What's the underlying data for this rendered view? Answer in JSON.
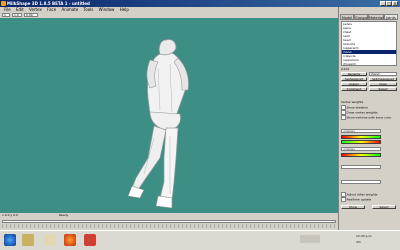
{
  "window": {
    "title": "MilkShape 3D 1.8.5 BETA 1 - untitled",
    "minimize": "_",
    "maximize": "□",
    "close": "×"
  },
  "menu": [
    "File",
    "Edit",
    "Vertex",
    "Face",
    "Animate",
    "Tools",
    "Window",
    "Help"
  ],
  "toolbar": {
    "frame_field": "1",
    "zoom_field": "1.0",
    "extra_field": "0.00"
  },
  "viewport": {
    "background": "#3d8f86"
  },
  "status": {
    "coords": "x 0.0 y 0.0",
    "message": "Ready"
  },
  "panel": {
    "tabs": [
      "Model",
      "Groups",
      "Materials",
      "Joints"
    ],
    "joints": [
      "pelvis",
      "spine",
      "chest",
      "neck",
      "head",
      "lclavicle",
      "lupperarm",
      "lforearm",
      "lhand",
      "rclavicle",
      "rupperarm",
      "rforearm"
    ],
    "selected_joint": "lhand",
    "group_label": "Joints",
    "buttons": [
      "Rename",
      "Select",
      "Unassign",
      "Comment",
      "Assign",
      "Clear",
      "SelAssigned",
      "SelUnassigned"
    ],
    "rename_field": "lhand",
    "weights_label": "Vertex weights",
    "checks": [
      "Show skeleton",
      "Draw vertex weights",
      "Show vertices with bone color"
    ],
    "bone_label": "<none>",
    "bone_label2": "<none>",
    "bottom_checks": [
      "Adjust other weights",
      "Realtime update"
    ],
    "bottom_buttons": [
      "Show",
      "Select"
    ]
  },
  "taskbar": {
    "clock": "12:43 p.m.",
    "date": "dm"
  }
}
